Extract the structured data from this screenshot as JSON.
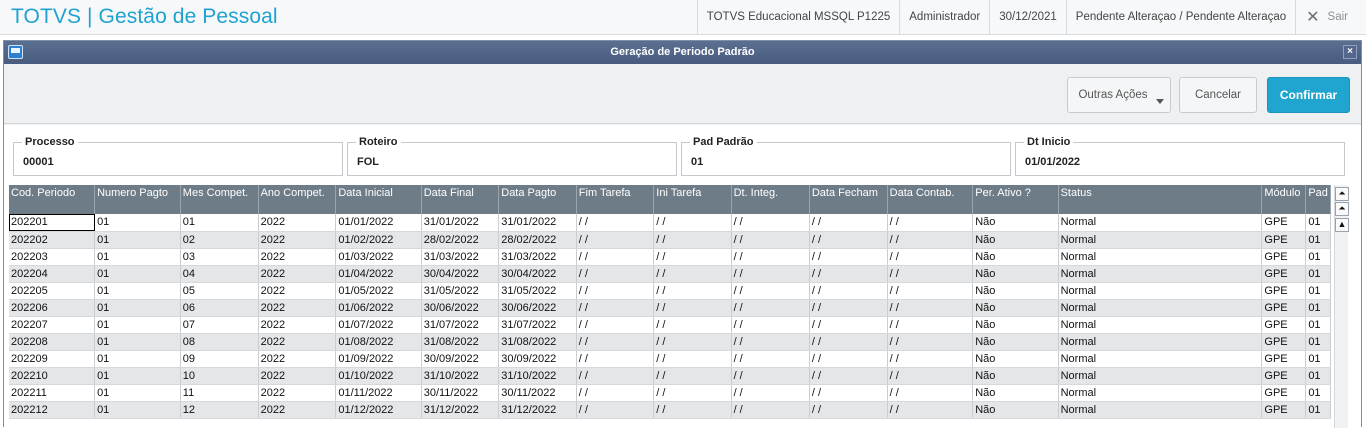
{
  "header": {
    "app_title": "TOTVS | Gestão de Pessoal",
    "environment": "TOTVS Educacional MSSQL P1225",
    "user": "Administrador",
    "date": "30/12/2021",
    "status": "Pendente Alteraçao / Pendente Alteraçao",
    "logout_label": "Sair"
  },
  "dialog": {
    "title": "Geração de Periodo Padrão",
    "close_glyph": "×"
  },
  "toolbar": {
    "outras_label": "Outras Ações",
    "cancel_label": "Cancelar",
    "confirm_label": "Confirmar"
  },
  "fields": [
    {
      "label": "Processo",
      "value": "00001"
    },
    {
      "label": "Roteiro",
      "value": "FOL"
    },
    {
      "label": "Pad Padrão",
      "value": "01"
    },
    {
      "label": "Dt Inicio",
      "value": "01/01/2022"
    }
  ],
  "grid": {
    "columns": [
      "Cod. Periodo",
      "Numero Pagto",
      "Mes Compet.",
      "Ano Compet.",
      "Data Inicial",
      "Data Final",
      "Data Pagto",
      "Fim Tarefa",
      "Ini Tarefa",
      "Dt. Integ.",
      "Data Fecham",
      "Data Contab.",
      "Per. Ativo ?",
      "Status",
      "Módulo",
      "Pad"
    ],
    "rows": [
      [
        "202201",
        "01",
        "01",
        "2022",
        "01/01/2022",
        "31/01/2022",
        "31/01/2022",
        " / /",
        " / /",
        " / /",
        " / /",
        " / /",
        "Não",
        "Normal",
        "GPE",
        "01"
      ],
      [
        "202202",
        "01",
        "02",
        "2022",
        "01/02/2022",
        "28/02/2022",
        "28/02/2022",
        " / /",
        " / /",
        " / /",
        " / /",
        " / /",
        "Não",
        "Normal",
        "GPE",
        "01"
      ],
      [
        "202203",
        "01",
        "03",
        "2022",
        "01/03/2022",
        "31/03/2022",
        "31/03/2022",
        " / /",
        " / /",
        " / /",
        " / /",
        " / /",
        "Não",
        "Normal",
        "GPE",
        "01"
      ],
      [
        "202204",
        "01",
        "04",
        "2022",
        "01/04/2022",
        "30/04/2022",
        "30/04/2022",
        " / /",
        " / /",
        " / /",
        " / /",
        " / /",
        "Não",
        "Normal",
        "GPE",
        "01"
      ],
      [
        "202205",
        "01",
        "05",
        "2022",
        "01/05/2022",
        "31/05/2022",
        "31/05/2022",
        " / /",
        " / /",
        " / /",
        " / /",
        " / /",
        "Não",
        "Normal",
        "GPE",
        "01"
      ],
      [
        "202206",
        "01",
        "06",
        "2022",
        "01/06/2022",
        "30/06/2022",
        "30/06/2022",
        " / /",
        " / /",
        " / /",
        " / /",
        " / /",
        "Não",
        "Normal",
        "GPE",
        "01"
      ],
      [
        "202207",
        "01",
        "07",
        "2022",
        "01/07/2022",
        "31/07/2022",
        "31/07/2022",
        " / /",
        " / /",
        " / /",
        " / /",
        " / /",
        "Não",
        "Normal",
        "GPE",
        "01"
      ],
      [
        "202208",
        "01",
        "08",
        "2022",
        "01/08/2022",
        "31/08/2022",
        "31/08/2022",
        " / /",
        " / /",
        " / /",
        " / /",
        " / /",
        "Não",
        "Normal",
        "GPE",
        "01"
      ],
      [
        "202209",
        "01",
        "09",
        "2022",
        "01/09/2022",
        "30/09/2022",
        "30/09/2022",
        " / /",
        " / /",
        " / /",
        " / /",
        " / /",
        "Não",
        "Normal",
        "GPE",
        "01"
      ],
      [
        "202210",
        "01",
        "10",
        "2022",
        "01/10/2022",
        "31/10/2022",
        "31/10/2022",
        " / /",
        " / /",
        " / /",
        " / /",
        " / /",
        "Não",
        "Normal",
        "GPE",
        "01"
      ],
      [
        "202211",
        "01",
        "11",
        "2022",
        "01/11/2022",
        "30/11/2022",
        "30/11/2022",
        " / /",
        " / /",
        " / /",
        " / /",
        " / /",
        "Não",
        "Normal",
        "GPE",
        "01"
      ],
      [
        "202212",
        "01",
        "12",
        "2022",
        "01/12/2022",
        "31/12/2022",
        "31/12/2022",
        " / /",
        " / /",
        " / /",
        " / /",
        " / /",
        "Não",
        "Normal",
        "GPE",
        "01"
      ]
    ]
  },
  "scroll_buttons": [
    "⏶",
    "⏶",
    "▲"
  ]
}
